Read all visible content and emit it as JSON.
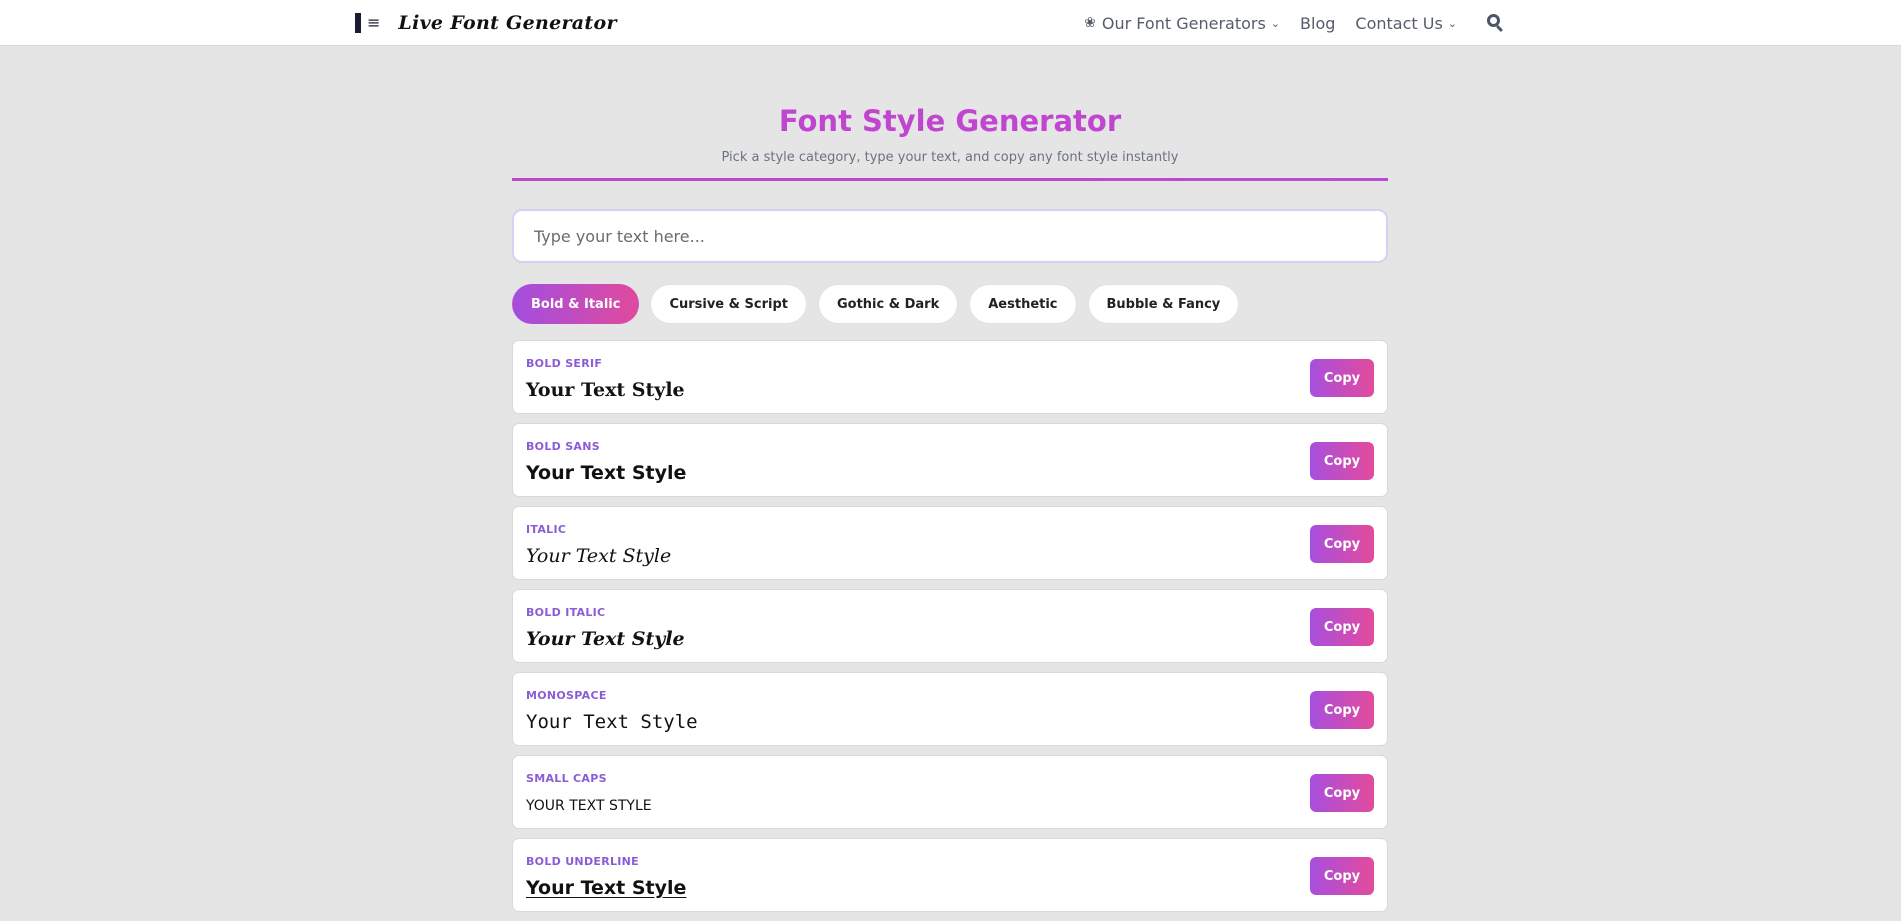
{
  "header": {
    "logo_text": "Live Font Generator",
    "nav": {
      "generators_label": "Our Font Generators",
      "blog_label": "Blog",
      "contact_label": "Contact Us"
    }
  },
  "main": {
    "title": "Font Style Generator",
    "subtitle": "Pick a style category, type your text, and copy any font style instantly",
    "input_placeholder": "Type your text here...",
    "tabs": [
      {
        "label": "Bold & Italic",
        "active": true
      },
      {
        "label": "Cursive & Script",
        "active": false
      },
      {
        "label": "Gothic & Dark",
        "active": false
      },
      {
        "label": "Aesthetic",
        "active": false
      },
      {
        "label": "Bubble & Fancy",
        "active": false
      }
    ],
    "styles": [
      {
        "label": "BOLD SERIF",
        "sample": "Your Text Style"
      },
      {
        "label": "BOLD SANS",
        "sample": "Your Text Style"
      },
      {
        "label": "ITALIC",
        "sample": "Your Text Style"
      },
      {
        "label": "BOLD ITALIC",
        "sample": "Your Text Style"
      },
      {
        "label": "MONOSPACE",
        "sample": "Your Text Style"
      },
      {
        "label": "SMALL CAPS",
        "sample": "YOUR TEXT STYLE"
      },
      {
        "label": "BOLD UNDERLINE",
        "sample": "Your Text Style"
      }
    ],
    "copy_label": "Copy"
  },
  "colors": {
    "accent": "#c046cf",
    "gradient_start": "#a24ee0",
    "gradient_end": "#e14a9c",
    "label_purple": "#8b5cd6",
    "background": "#e5e5e5"
  },
  "icons": {
    "logo": "menu-lines-icon",
    "flower": "flower-icon",
    "chevron": "chevron-down-icon",
    "search": "search-icon"
  }
}
